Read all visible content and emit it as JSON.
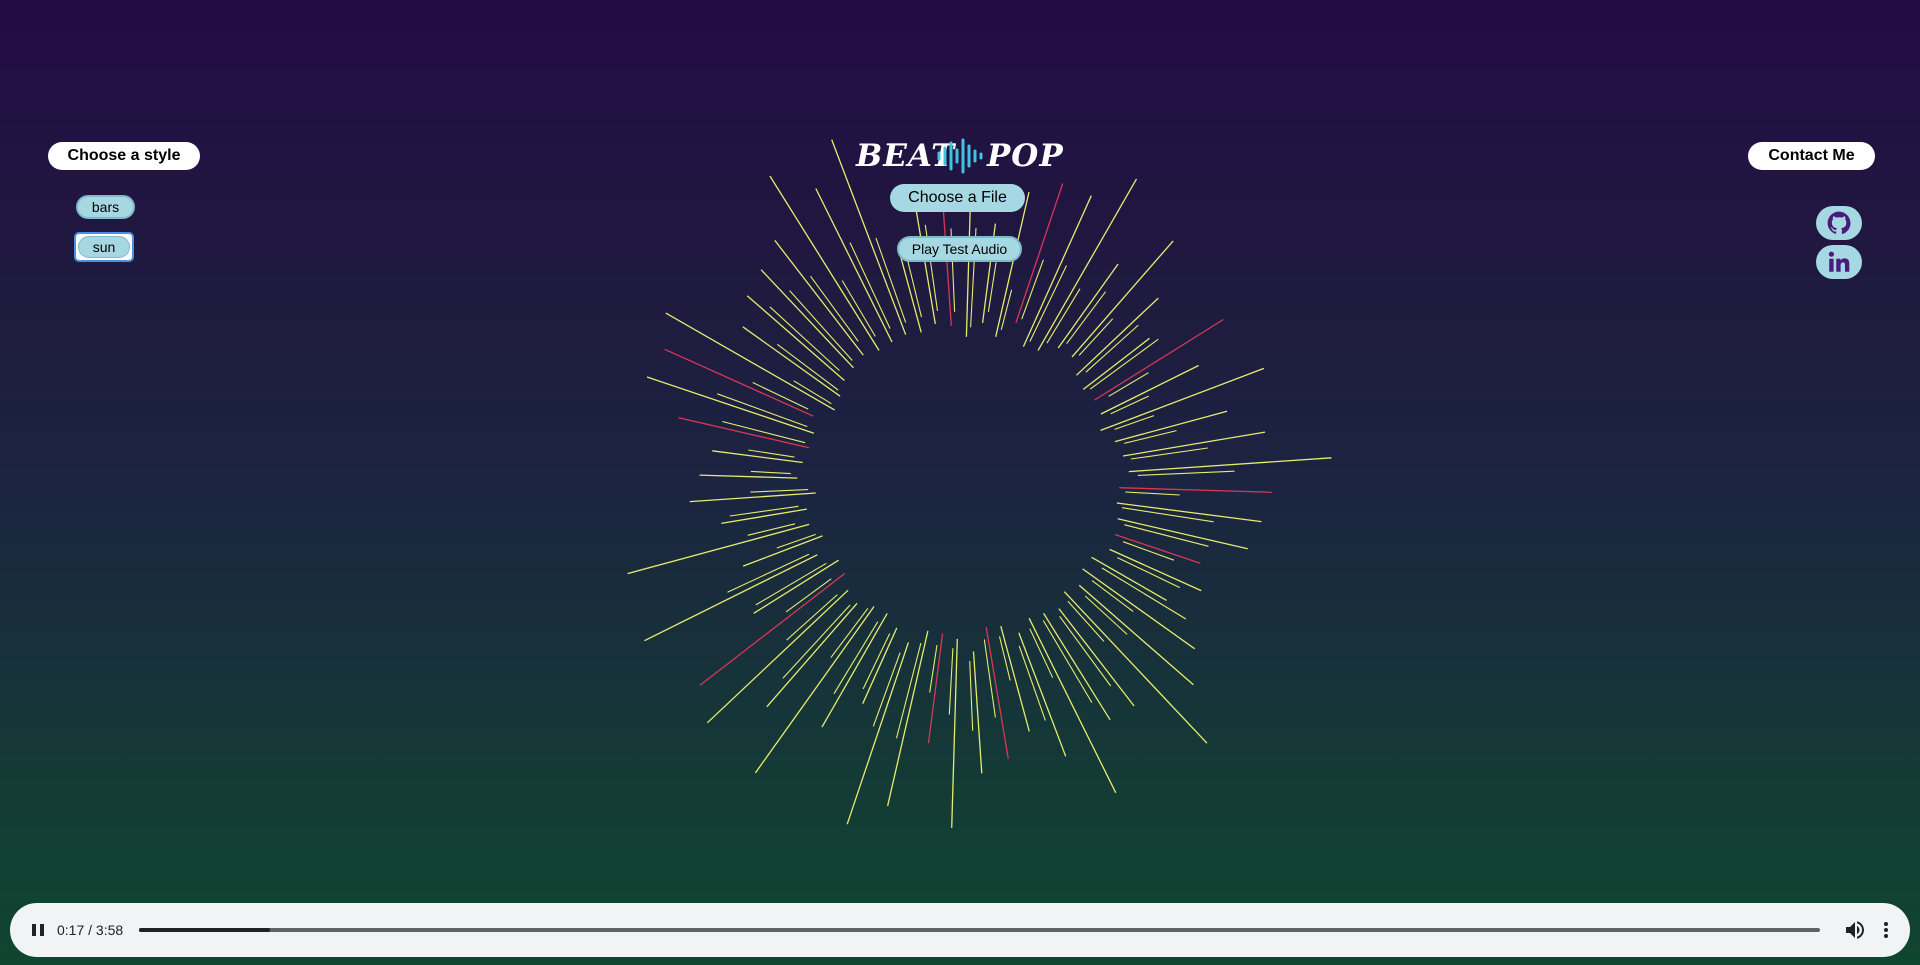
{
  "sidebar": {
    "heading": "Choose a style",
    "styles": [
      {
        "label": "bars",
        "selected": false
      },
      {
        "label": "sun",
        "selected": true
      }
    ]
  },
  "header": {
    "logo": {
      "left": "BEAT",
      "right": "POP",
      "wave_icon": "sound-wave-icon"
    },
    "choose_file_label": "Choose a File",
    "play_test_label": "Play Test Audio"
  },
  "contact": {
    "label": "Contact Me",
    "links": [
      {
        "icon": "github-icon"
      },
      {
        "icon": "linkedin-icon"
      }
    ]
  },
  "player": {
    "state": "playing",
    "time": "0:17 / 3:58",
    "progress": 0.078,
    "icons": {
      "play_pause": "pause-icon",
      "volume": "volume-icon",
      "more": "more-vert-icon"
    }
  },
  "colors": {
    "accent": "#a5d8e3",
    "ray_primary": "#e6ec6b",
    "ray_secondary": "#d9365a",
    "logo_wave": "#3fc5e0",
    "background_top": "#230b45",
    "background_bottom": "#0f4630"
  }
}
